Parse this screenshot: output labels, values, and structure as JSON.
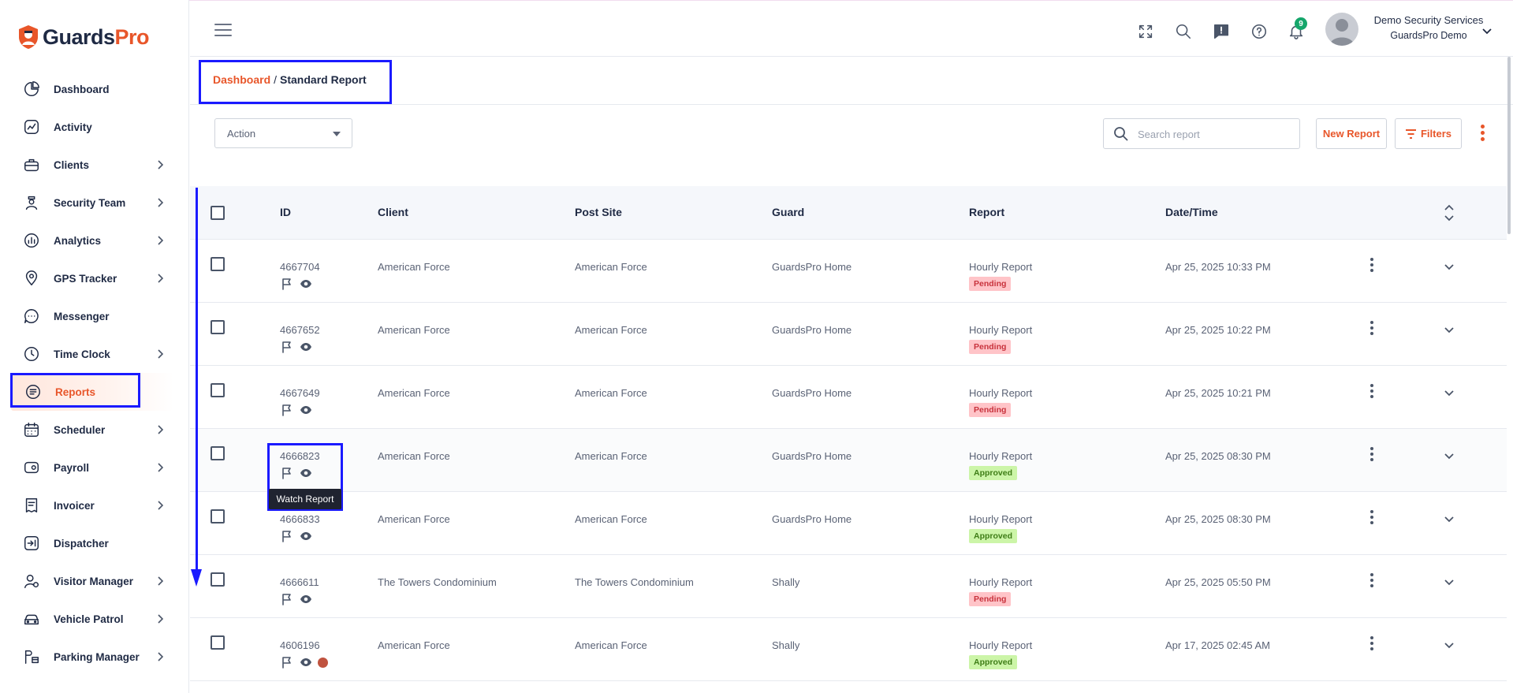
{
  "brand": {
    "part1": "Guards",
    "part2": "Pro"
  },
  "sidebar": {
    "items": [
      {
        "label": "Dashboard",
        "icon": "dashboard-icon",
        "chevron": false
      },
      {
        "label": "Activity",
        "icon": "activity-icon",
        "chevron": false
      },
      {
        "label": "Clients",
        "icon": "clients-icon",
        "chevron": true
      },
      {
        "label": "Security Team",
        "icon": "security-team-icon",
        "chevron": true
      },
      {
        "label": "Analytics",
        "icon": "analytics-icon",
        "chevron": true
      },
      {
        "label": "GPS Tracker",
        "icon": "gps-icon",
        "chevron": true
      },
      {
        "label": "Messenger",
        "icon": "messenger-icon",
        "chevron": false
      },
      {
        "label": "Time Clock",
        "icon": "clock-icon",
        "chevron": true
      },
      {
        "label": "Reports",
        "icon": "reports-icon",
        "chevron": false,
        "active": true
      },
      {
        "label": "Scheduler",
        "icon": "calendar-icon",
        "chevron": true
      },
      {
        "label": "Payroll",
        "icon": "payroll-icon",
        "chevron": true
      },
      {
        "label": "Invoicer",
        "icon": "invoice-icon",
        "chevron": true
      },
      {
        "label": "Dispatcher",
        "icon": "dispatcher-icon",
        "chevron": false
      },
      {
        "label": "Visitor Manager",
        "icon": "visitor-icon",
        "chevron": true
      },
      {
        "label": "Vehicle Patrol",
        "icon": "car-icon",
        "chevron": true
      },
      {
        "label": "Parking Manager",
        "icon": "parking-icon",
        "chevron": true
      }
    ]
  },
  "header": {
    "notification_count": "9",
    "user_name": "Demo Security Services",
    "user_company": "GuardsPro Demo"
  },
  "breadcrumb": {
    "home": "Dashboard",
    "separator": "/",
    "current": "Standard Report"
  },
  "toolbar": {
    "action_label": "Action",
    "search_placeholder": "Search report",
    "new_report": "New Report",
    "filters": "Filters"
  },
  "table": {
    "columns": [
      "ID",
      "Client",
      "Post Site",
      "Guard",
      "Report",
      "Date/Time"
    ],
    "rows": [
      {
        "id": "4667704",
        "client": "American Force",
        "site": "American Force",
        "guard": "GuardsPro Home",
        "report": "Hourly Report",
        "status": "Pending",
        "datetime": "Apr 25, 2025 10:33 PM"
      },
      {
        "id": "4667652",
        "client": "American Force",
        "site": "American Force",
        "guard": "GuardsPro Home",
        "report": "Hourly Report",
        "status": "Pending",
        "datetime": "Apr 25, 2025 10:22 PM"
      },
      {
        "id": "4667649",
        "client": "American Force",
        "site": "American Force",
        "guard": "GuardsPro Home",
        "report": "Hourly Report",
        "status": "Pending",
        "datetime": "Apr 25, 2025 10:21 PM"
      },
      {
        "id": "4666823",
        "client": "American Force",
        "site": "American Force",
        "guard": "GuardsPro Home",
        "report": "Hourly Report",
        "status": "Approved",
        "datetime": "Apr 25, 2025 08:30 PM"
      },
      {
        "id": "4666833",
        "client": "American Force",
        "site": "American Force",
        "guard": "GuardsPro Home",
        "report": "Hourly Report",
        "status": "Approved",
        "datetime": "Apr 25, 2025 08:30 PM"
      },
      {
        "id": "4666611",
        "client": "The Towers Condominium",
        "site": "The Towers Condominium",
        "guard": "Shally",
        "report": "Hourly Report",
        "status": "Pending",
        "datetime": "Apr 25, 2025 05:50 PM"
      },
      {
        "id": "4606196",
        "client": "American Force",
        "site": "American Force",
        "guard": "Shally",
        "report": "Hourly Report",
        "status": "Approved",
        "datetime": "Apr 17, 2025 02:45 AM"
      }
    ]
  },
  "tooltip": "Watch Report",
  "colors": {
    "accent": "#e8562a",
    "highlight": "#1a1aff",
    "pending_bg": "#ffc4c8",
    "approved_bg": "#ccf5a8"
  }
}
